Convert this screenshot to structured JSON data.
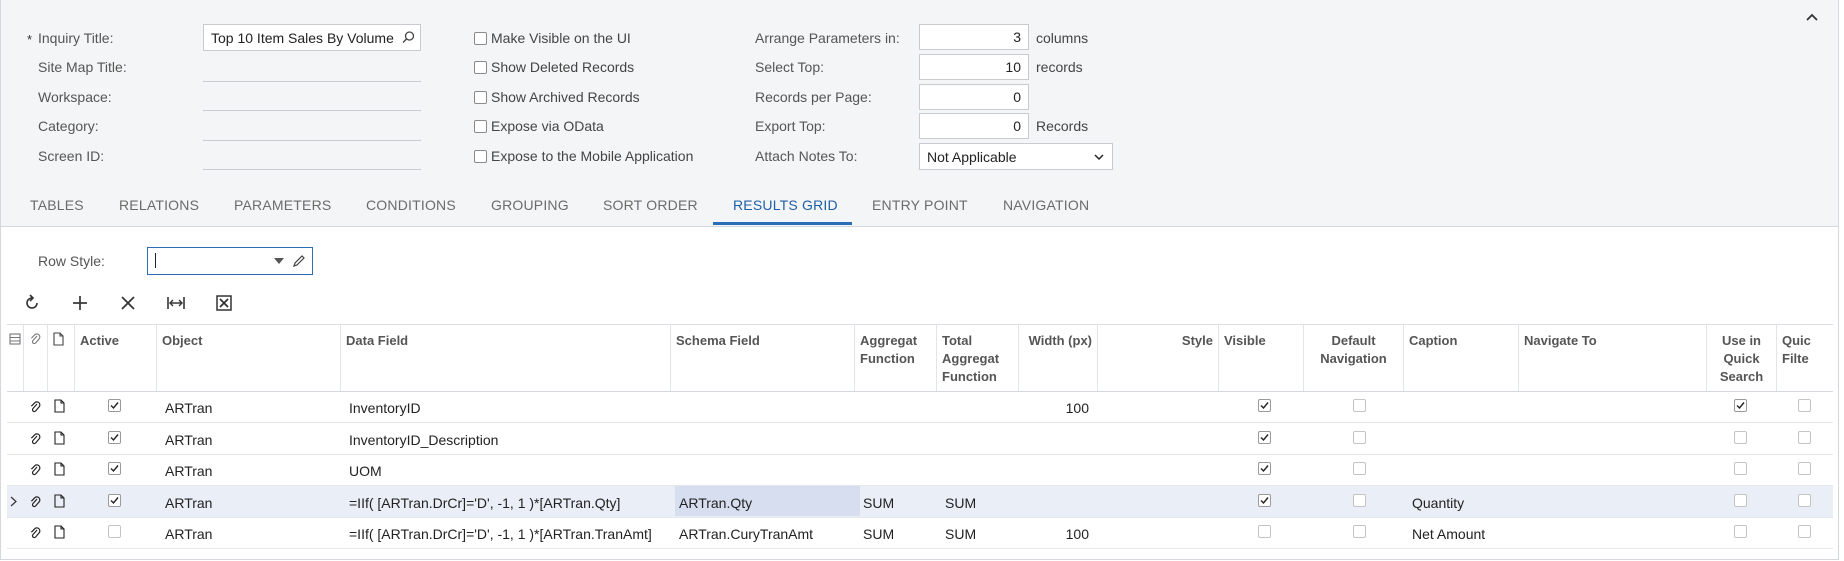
{
  "form": {
    "required_mark": "*",
    "labels": {
      "inquiry_title": "Inquiry Title:",
      "site_map_title": "Site Map Title:",
      "workspace": "Workspace:",
      "category": "Category:",
      "screen_id": "Screen ID:"
    },
    "inquiry_title_value": "Top 10 Item Sales By Volume",
    "checkboxes": [
      {
        "label": "Make Visible on the UI",
        "checked": false
      },
      {
        "label": "Show Deleted Records",
        "checked": false
      },
      {
        "label": "Show Archived Records",
        "checked": false
      },
      {
        "label": "Expose via OData",
        "checked": false
      },
      {
        "label": "Expose to the Mobile Application",
        "checked": false
      }
    ],
    "params": {
      "arrange_label": "Arrange Parameters in:",
      "arrange_value": "3",
      "arrange_unit": "columns",
      "select_top_label": "Select Top:",
      "select_top_value": "10",
      "select_top_unit": "records",
      "records_per_page_label": "Records per Page:",
      "records_per_page_value": "0",
      "export_top_label": "Export Top:",
      "export_top_value": "0",
      "export_top_unit": "Records",
      "attach_notes_label": "Attach Notes To:",
      "attach_notes_value": "Not Applicable"
    }
  },
  "tabs": [
    "TABLES",
    "RELATIONS",
    "PARAMETERS",
    "CONDITIONS",
    "GROUPING",
    "SORT ORDER",
    "RESULTS GRID",
    "ENTRY POINT",
    "NAVIGATION"
  ],
  "active_tab": "RESULTS GRID",
  "row_style": {
    "label": "Row Style:",
    "value": ""
  },
  "toolbar": [
    "refresh-icon",
    "add-icon",
    "delete-icon",
    "fit-columns-icon",
    "export-excel-icon"
  ],
  "grid": {
    "headers": {
      "active": "Active",
      "object": "Object",
      "data_field": "Data Field",
      "schema_field": "Schema Field",
      "agg_function": "Aggregat Function",
      "total_agg": "Total Aggregat Function",
      "width": "Width (px)",
      "style": "Style",
      "visible": "Visible",
      "default_nav": "Default Navigation",
      "caption": "Caption",
      "navigate_to": "Navigate To",
      "quick_search": "Use in Quick Search",
      "quick_filter": "Quic Filte"
    },
    "rows": [
      {
        "active": true,
        "object": "ARTran",
        "data_field": "InventoryID",
        "schema_field": "",
        "agg": "",
        "total_agg": "",
        "width": "100",
        "visible": true,
        "default_nav": false,
        "caption": "",
        "quick_search": true,
        "quick_filter": false,
        "selected": false
      },
      {
        "active": true,
        "object": "ARTran",
        "data_field": "InventoryID_Description",
        "schema_field": "",
        "agg": "",
        "total_agg": "",
        "width": "",
        "visible": true,
        "default_nav": false,
        "caption": "",
        "quick_search": false,
        "quick_filter": false,
        "selected": false
      },
      {
        "active": true,
        "object": "ARTran",
        "data_field": "UOM",
        "schema_field": "",
        "agg": "",
        "total_agg": "",
        "width": "",
        "visible": true,
        "default_nav": false,
        "caption": "",
        "quick_search": false,
        "quick_filter": false,
        "selected": false
      },
      {
        "active": true,
        "object": "ARTran",
        "data_field": "=IIf( [ARTran.DrCr]='D', -1, 1 )*[ARTran.Qty]",
        "schema_field": "ARTran.Qty",
        "agg": "SUM",
        "total_agg": "SUM",
        "width": "",
        "visible": true,
        "default_nav": false,
        "caption": "Quantity",
        "quick_search": false,
        "quick_filter": false,
        "selected": true
      },
      {
        "active": false,
        "object": "ARTran",
        "data_field": "=IIf( [ARTran.DrCr]='D', -1, 1 )*[ARTran.TranAmt]",
        "schema_field": "ARTran.CuryTranAmt",
        "agg": "SUM",
        "total_agg": "SUM",
        "width": "100",
        "visible": false,
        "default_nav": false,
        "caption": "Net Amount",
        "quick_search": false,
        "quick_filter": false,
        "selected": false
      }
    ]
  },
  "colors": {
    "accent": "#1f5fa8",
    "panel_bg": "#f4f5f6",
    "selected_row": "#eaeef6",
    "schema_highlight": "#d7def0"
  }
}
